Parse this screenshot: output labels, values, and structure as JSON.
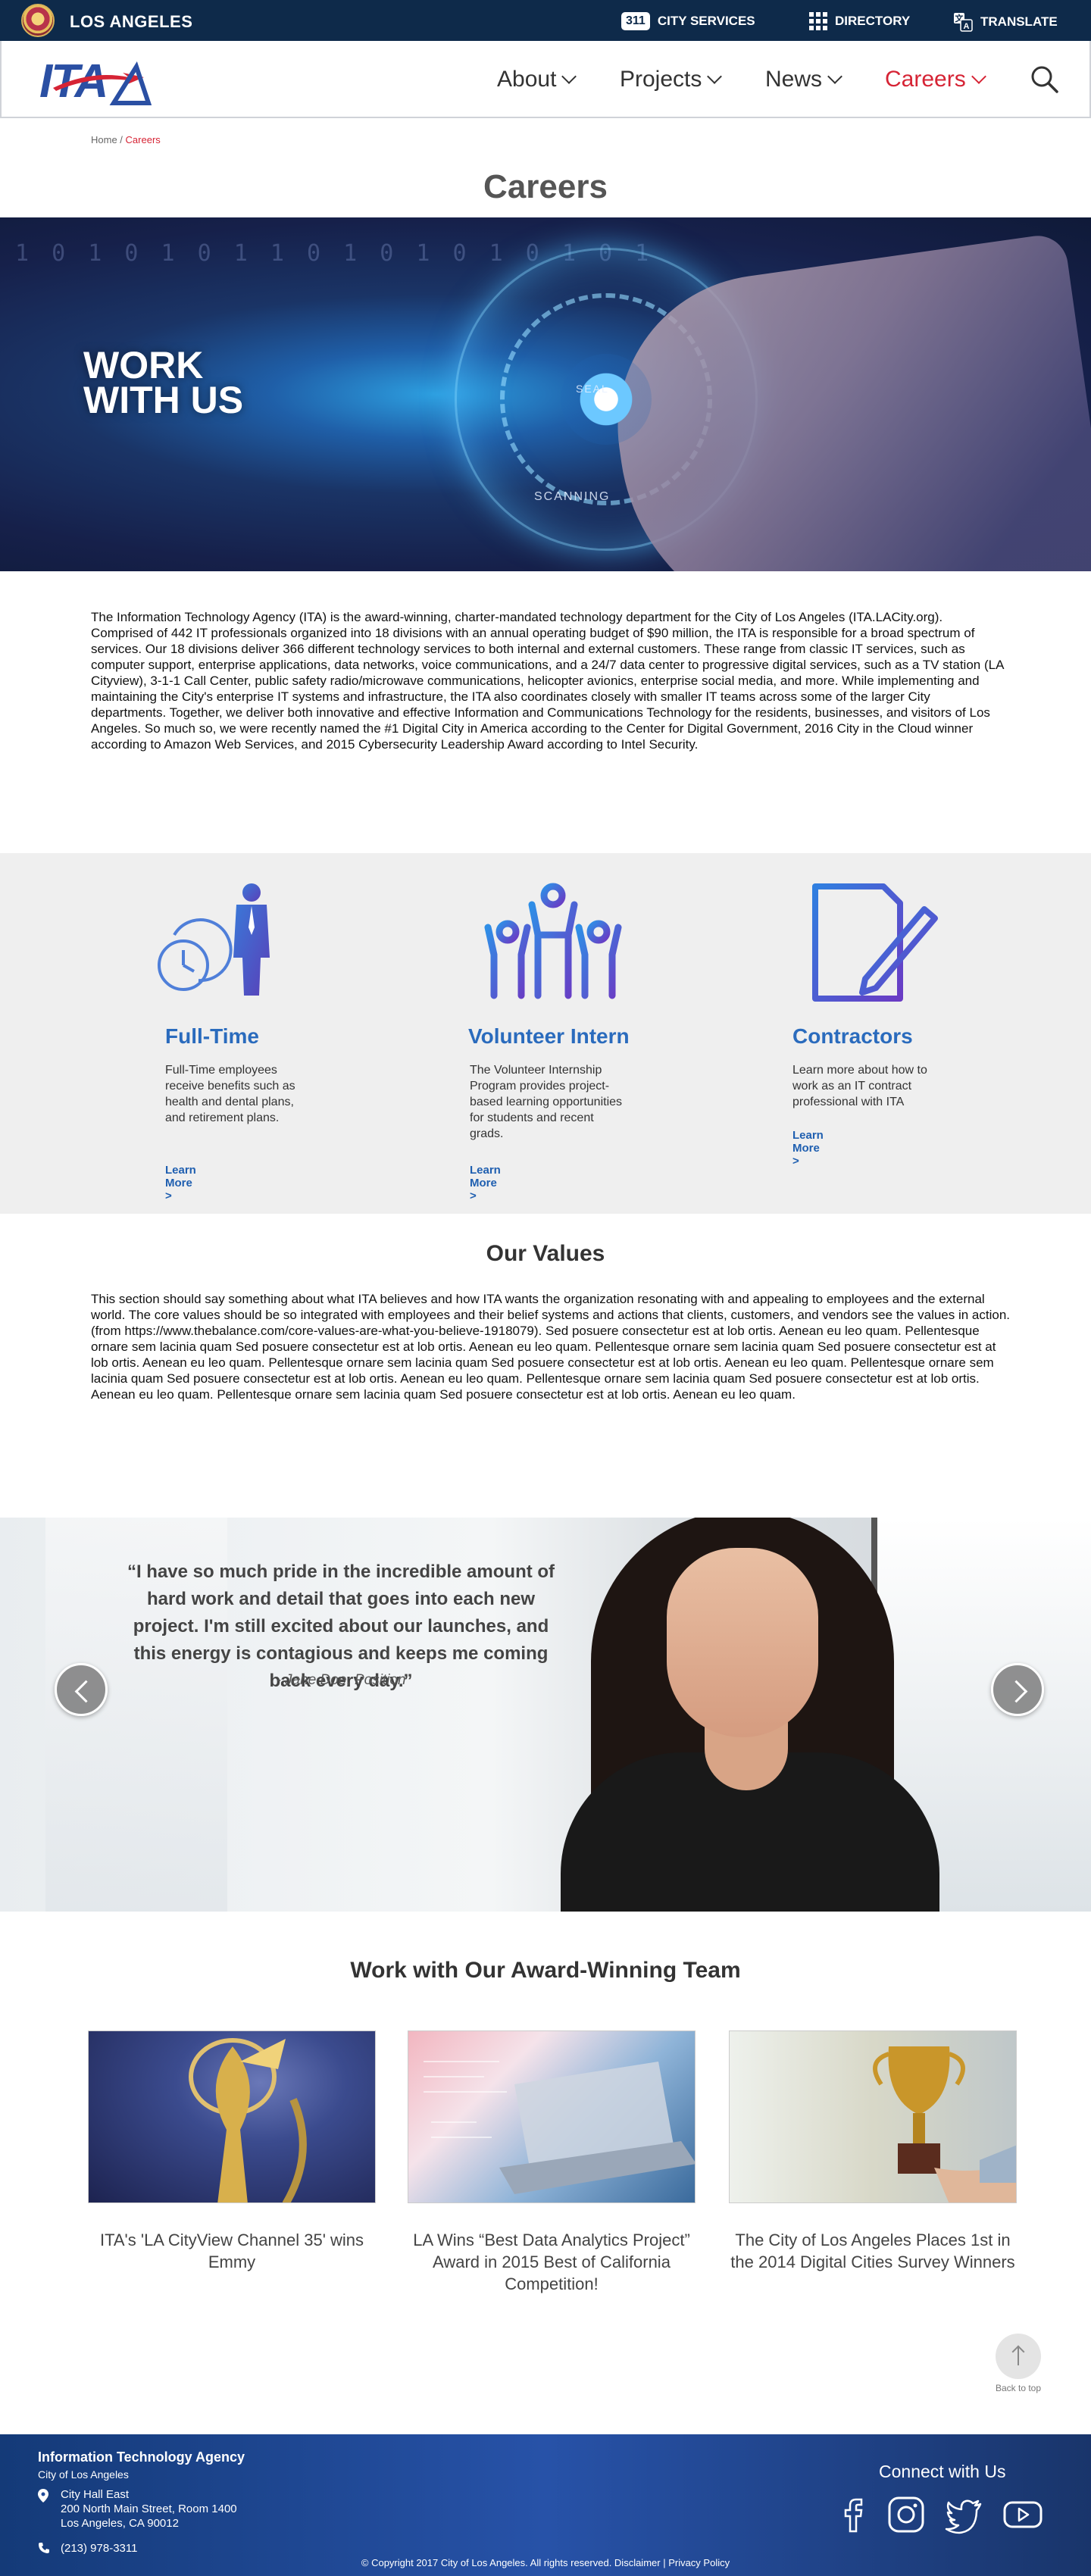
{
  "topbar": {
    "city_name": "LOS ANGELES",
    "badge_311": "311",
    "city_services": "CITY SERVICES",
    "directory": "DIRECTORY",
    "translate": "TRANSLATE",
    "background": "#0e2a4a"
  },
  "nav": {
    "items": [
      "About",
      "Projects",
      "News",
      "Careers"
    ],
    "active": "Careers",
    "active_color": "#d62435",
    "logo_text": "ITA"
  },
  "breadcrumb": {
    "home": "Home",
    "separator": " / ",
    "current": "Careers"
  },
  "page_title": "Careers",
  "hero": {
    "headline_line1": "WORK",
    "headline_line2": "WITH US",
    "overlay_1": "SEAL",
    "overlay_2": "SCANNING",
    "binary": "1 0 1 0 1 0 1 1 0 1 0 1 0 1 0 1 0 1"
  },
  "intro": "The Information Technology Agency (ITA) is the award-winning, charter-mandated technology department for the City of Los Angeles (ITA.LACity.org). Comprised of 442 IT professionals organized into 18 divisions with an annual operating budget of $90 million, the ITA is responsible for a broad spectrum of services. Our 18 divisions deliver 366 different technology services to both internal and external customers. These range from classic IT services, such as computer support, enterprise applications, data networks, voice communications, and a 24/7 data center to progressive digital services, such as a TV station (LA Cityview), 3-1-1 Call Center, public safety radio/microwave communications, helicopter avionics, enterprise social media, and more. While implementing and maintaining the City's enterprise IT systems and infrastructure, the ITA also coordinates closely with smaller IT teams across some of the larger City departments. Together, we deliver both innovative and effective Information and Communications Technology for the residents, businesses, and visitors of Los Angeles. So much so, we were recently named the #1 Digital City in America according to the Center for Digital Government, 2016 City in the Cloud winner according to Amazon Web Services, and 2015 Cybersecurity Leadership Award according to Intel Security.",
  "cards": [
    {
      "title": "Full-Time",
      "text": "Full-Time employees receive benefits such as health and dental plans, and retirement plans.",
      "link": "Learn More >",
      "icon": "clock-employee-icon"
    },
    {
      "title": "Volunteer Intern",
      "text": "The Volunteer Internship Program provides project-based learning opportunities for students and recent grads.",
      "link": "Learn More >",
      "icon": "people-group-icon"
    },
    {
      "title": "Contractors",
      "text": "Learn more about how to work as an IT contract professional with ITA",
      "link": "Learn More >",
      "icon": "document-pen-icon"
    }
  ],
  "values": {
    "title": "Our Values",
    "text": "This section should say something about what ITA believes and how ITA wants the organization resonating with and appealing to employees and the external world. The core values should be so integrated with employees and their belief systems and actions that clients, customers, and vendors see the values in action. (from https://www.thebalance.com/core-values-are-what-you-believe-1918079). Sed posuere consectetur est at lob ortis. Aenean eu leo quam. Pellentesque ornare sem lacinia quam Sed posuere consectetur est at lob ortis. Aenean eu leo quam. Pellentesque ornare sem lacinia quam Sed posuere consectetur est at lob ortis. Aenean eu leo quam. Pellentesque ornare sem lacinia quam Sed posuere consectetur est at lob ortis. Aenean eu leo quam. Pellentesque ornare sem lacinia quam Sed posuere consectetur est at lob ortis. Aenean eu leo quam. Pellentesque ornare sem lacinia quam Sed posuere consectetur est at lob ortis. Aenean eu leo quam. Pellentesque ornare sem lacinia quam Sed posuere consectetur est at lob ortis. Aenean eu leo quam."
  },
  "testimonial": {
    "quote": "“I have so much pride in the incredible amount of hard work and detail that goes into each new project. I'm still excited about our launches, and this energy is contagious and keeps me coming back every day.”",
    "author": "- Jane Doe, Position"
  },
  "awards": {
    "title": "Work with Our Award-Winning Team",
    "items": [
      {
        "caption": "ITA's 'LA CityView Channel 35' wins Emmy"
      },
      {
        "caption": "LA Wins “Best Data Analytics Project” Award in 2015 Best of California Competition!"
      },
      {
        "caption": "The City of Los Angeles Places 1st in the 2014 Digital Cities Survey Winners"
      }
    ]
  },
  "back_to_top": "Back to top",
  "footer": {
    "org": "Information Technology Agency",
    "sub": "City of Los Angeles",
    "address_line1": "City Hall East",
    "address_line2": "200 North Main Street, Room 1400",
    "address_line3": "Los Angeles, CA 90012",
    "phone": "(213) 978-3311",
    "connect": "Connect with Us",
    "social": [
      "facebook-icon",
      "instagram-icon",
      "twitter-icon",
      "youtube-icon"
    ],
    "copyright": "© Copyright 2017 City of Los Angeles. All rights reserved. Disclaimer | Privacy Policy"
  }
}
